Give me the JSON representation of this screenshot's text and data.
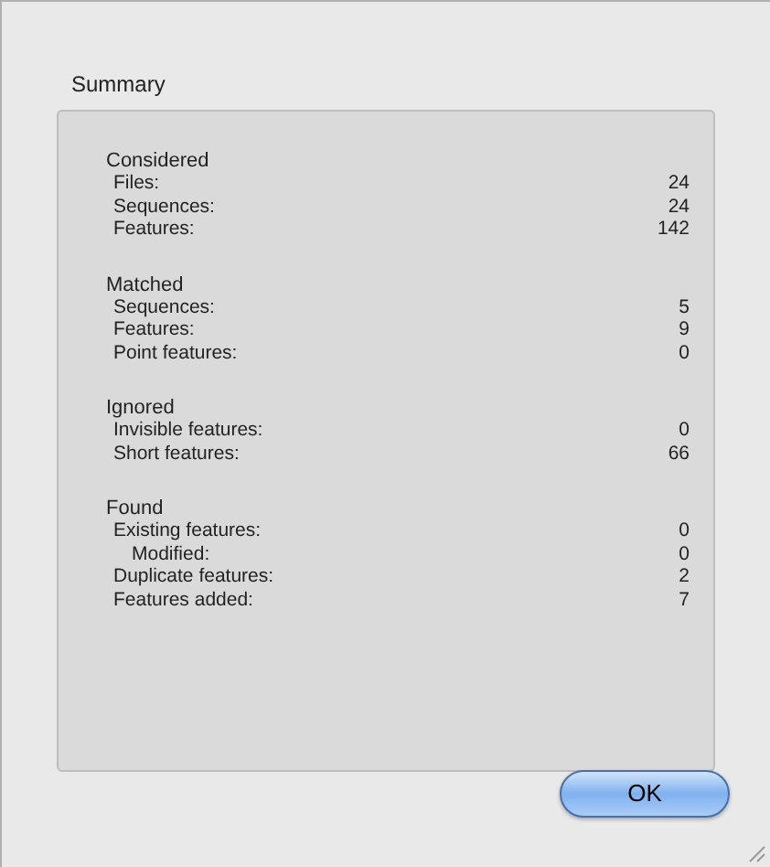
{
  "group_title": "Summary",
  "sections": [
    {
      "title": "Considered",
      "items": [
        {
          "label": "Files:",
          "value": "24"
        },
        {
          "label": "Sequences:",
          "value": "24"
        },
        {
          "label": "Features:",
          "value": "142"
        }
      ]
    },
    {
      "title": "Matched",
      "items": [
        {
          "label": "Sequences:",
          "value": "5"
        },
        {
          "label": "Features:",
          "value": "9"
        },
        {
          "label": "Point features:",
          "value": "0"
        }
      ]
    },
    {
      "title": "Ignored",
      "items": [
        {
          "label": "Invisible features:",
          "value": "0"
        },
        {
          "label": "Short features:",
          "value": "66"
        }
      ]
    },
    {
      "title": "Found",
      "items": [
        {
          "label": "Existing features:",
          "value": "0",
          "children": [
            {
              "label": "Modified:",
              "value": "0"
            }
          ]
        },
        {
          "label": "Duplicate features:",
          "value": "2"
        },
        {
          "label": "Features added:",
          "value": "7"
        }
      ]
    }
  ],
  "buttons": [
    "OK"
  ]
}
